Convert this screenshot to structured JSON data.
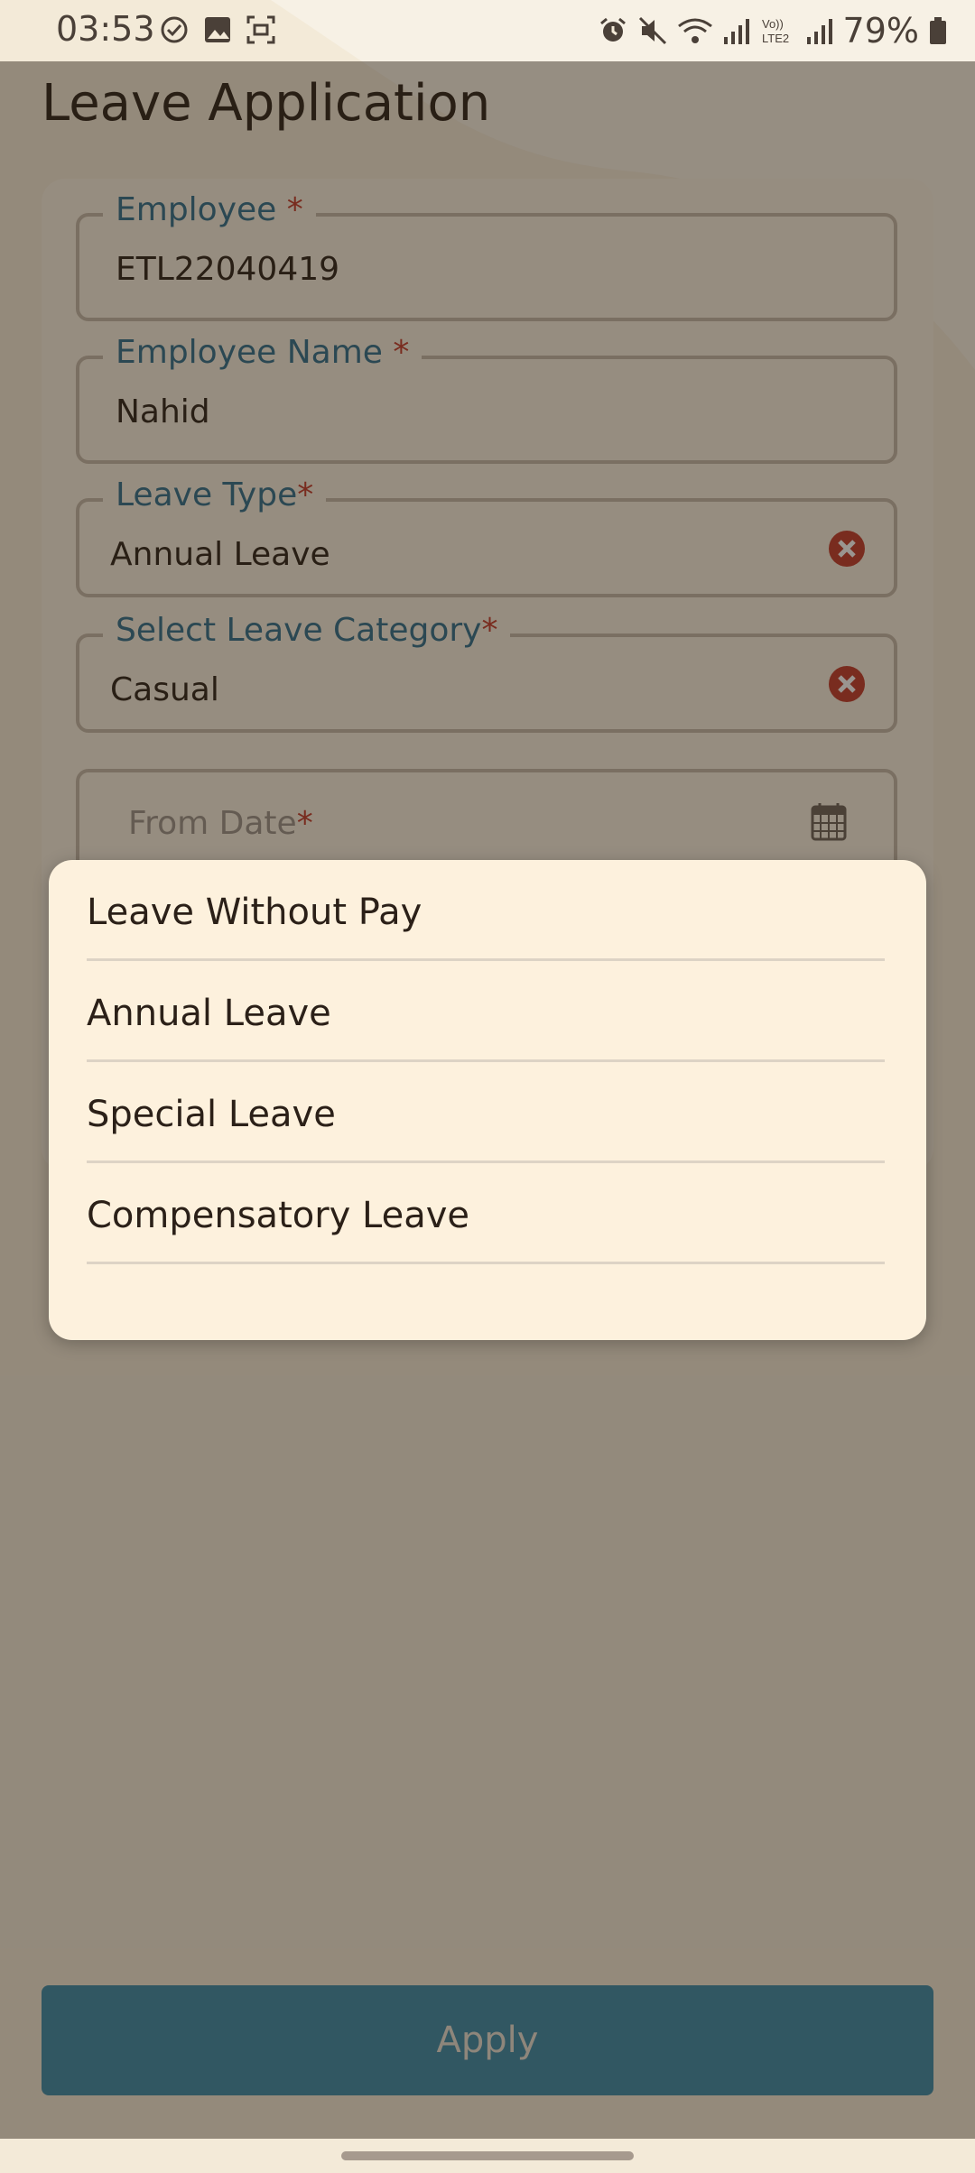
{
  "status_bar": {
    "time": "03:53",
    "battery": "79%",
    "icons_left": [
      "task-check-icon",
      "gallery-icon",
      "screenshot-icon"
    ],
    "icons_right": [
      "alarm-icon",
      "mute-icon",
      "wifi-icon",
      "signal-icon",
      "volte-icon",
      "signal-icon",
      "battery-icon"
    ]
  },
  "page": {
    "title": "Leave Application"
  },
  "form": {
    "employee": {
      "label": "Employee",
      "required": "*",
      "value": "ETL22040419"
    },
    "employee_name": {
      "label": "Employee Name",
      "required": "*",
      "value": "Nahid"
    },
    "leave_type": {
      "label": "Leave Type",
      "required": "*",
      "value": "Annual Leave"
    },
    "leave_category": {
      "label": "Select Leave Category",
      "required": "*",
      "value": "Casual"
    },
    "from_date": {
      "placeholder": "From Date",
      "required": "*"
    }
  },
  "apply_button": {
    "label": "Apply"
  },
  "dropdown": {
    "options": [
      "Leave Without Pay",
      "Annual Leave",
      "Special Leave",
      "Compensatory Leave"
    ]
  },
  "colors": {
    "accent": "#3a8aa8",
    "label": "#2f6f8c",
    "required": "#c0392b",
    "clear": "#c0392b"
  }
}
